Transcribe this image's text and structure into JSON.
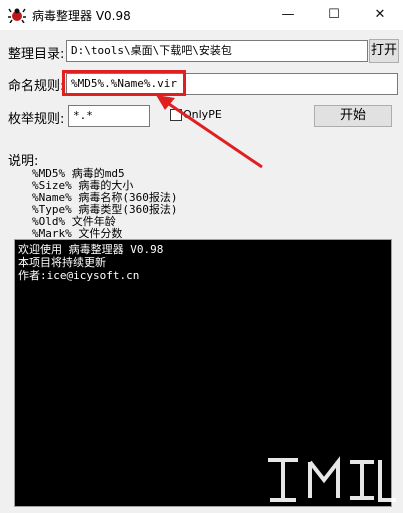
{
  "window": {
    "title": "病毒整理器 V0.98",
    "minimize_glyph": "—",
    "maximize_glyph": "☐",
    "close_glyph": "✕",
    "app_icon": "virus-bug-icon"
  },
  "form": {
    "dir_label": "整理目录:",
    "dir_value": "D:\\tools\\桌面\\下载吧\\安装包",
    "open_button": "打开",
    "rule_label": "命名规则:",
    "rule_value": "%MD5%.%Name%.vir",
    "enum_label": "枚举规则:",
    "enum_value": "*.*",
    "onlype_label": "OnlyPE",
    "onlype_checked": false,
    "start_button": "开始"
  },
  "description": {
    "heading": "说明:",
    "lines": [
      "%MD5%  病毒的md5",
      "%Size% 病毒的大小",
      "%Name% 病毒名称(360报法)",
      "%Type% 病毒类型(360报法)",
      "%Old%  文件年龄",
      "%Mark% 文件分数"
    ]
  },
  "console": {
    "lines": [
      "欢迎使用 病毒整理器 V0.98",
      "本项目将持续更新",
      "作者:ice@icysoft.cn"
    ]
  },
  "colors": {
    "highlight": "#e02020",
    "console_bg": "#000000",
    "console_text": "#ffffff",
    "window_bg": "#f0f0f0"
  }
}
